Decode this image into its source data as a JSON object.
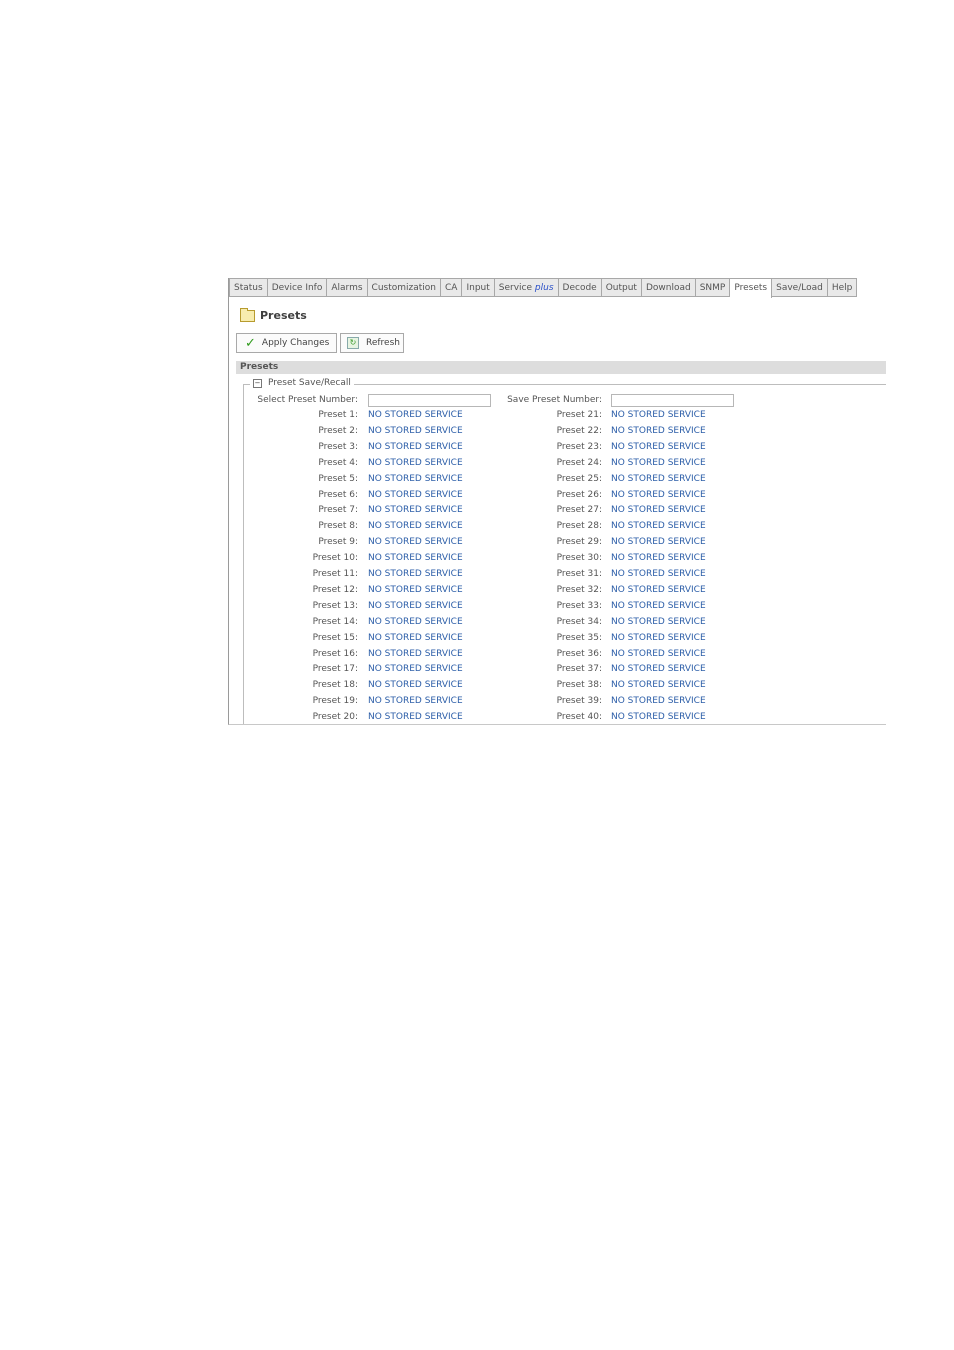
{
  "tabs": [
    {
      "label": "Status",
      "active": false
    },
    {
      "label": "Device Info",
      "active": false
    },
    {
      "label": "Alarms",
      "active": false
    },
    {
      "label": "Customization",
      "active": false
    },
    {
      "label": "CA",
      "active": false
    },
    {
      "label": "Input",
      "active": false
    },
    {
      "label": "Service",
      "suffix": "plus",
      "active": false
    },
    {
      "label": "Decode",
      "active": false
    },
    {
      "label": "Output",
      "active": false
    },
    {
      "label": "Download",
      "active": false
    },
    {
      "label": "SNMP",
      "active": false
    },
    {
      "label": "Presets",
      "active": true
    },
    {
      "label": "Save/Load",
      "active": false
    },
    {
      "label": "Help",
      "active": false
    }
  ],
  "page": {
    "title": "Presets",
    "icon": "folder-icon"
  },
  "toolbar": {
    "apply_label": "Apply Changes",
    "refresh_label": "Refresh"
  },
  "section": {
    "header": "Presets",
    "fieldset_legend": "Preset Save/Recall"
  },
  "form": {
    "select_label": "Select Preset Number:",
    "select_value": "",
    "save_label": "Save Preset Number:",
    "save_value": ""
  },
  "presets_left": [
    {
      "label": "Preset 1:",
      "value": "NO STORED SERVICE"
    },
    {
      "label": "Preset 2:",
      "value": "NO STORED SERVICE"
    },
    {
      "label": "Preset 3:",
      "value": "NO STORED SERVICE"
    },
    {
      "label": "Preset 4:",
      "value": "NO STORED SERVICE"
    },
    {
      "label": "Preset 5:",
      "value": "NO STORED SERVICE"
    },
    {
      "label": "Preset 6:",
      "value": "NO STORED SERVICE"
    },
    {
      "label": "Preset 7:",
      "value": "NO STORED SERVICE"
    },
    {
      "label": "Preset 8:",
      "value": "NO STORED SERVICE"
    },
    {
      "label": "Preset 9:",
      "value": "NO STORED SERVICE"
    },
    {
      "label": "Preset 10:",
      "value": "NO STORED SERVICE"
    },
    {
      "label": "Preset 11:",
      "value": "NO STORED SERVICE"
    },
    {
      "label": "Preset 12:",
      "value": "NO STORED SERVICE"
    },
    {
      "label": "Preset 13:",
      "value": "NO STORED SERVICE"
    },
    {
      "label": "Preset 14:",
      "value": "NO STORED SERVICE"
    },
    {
      "label": "Preset 15:",
      "value": "NO STORED SERVICE"
    },
    {
      "label": "Preset 16:",
      "value": "NO STORED SERVICE"
    },
    {
      "label": "Preset 17:",
      "value": "NO STORED SERVICE"
    },
    {
      "label": "Preset 18:",
      "value": "NO STORED SERVICE"
    },
    {
      "label": "Preset 19:",
      "value": "NO STORED SERVICE"
    },
    {
      "label": "Preset 20:",
      "value": "NO STORED SERVICE"
    }
  ],
  "presets_right": [
    {
      "label": "Preset 21:",
      "value": "NO STORED SERVICE"
    },
    {
      "label": "Preset 22:",
      "value": "NO STORED SERVICE"
    },
    {
      "label": "Preset 23:",
      "value": "NO STORED SERVICE"
    },
    {
      "label": "Preset 24:",
      "value": "NO STORED SERVICE"
    },
    {
      "label": "Preset 25:",
      "value": "NO STORED SERVICE"
    },
    {
      "label": "Preset 26:",
      "value": "NO STORED SERVICE"
    },
    {
      "label": "Preset 27:",
      "value": "NO STORED SERVICE"
    },
    {
      "label": "Preset 28:",
      "value": "NO STORED SERVICE"
    },
    {
      "label": "Preset 29:",
      "value": "NO STORED SERVICE"
    },
    {
      "label": "Preset 30:",
      "value": "NO STORED SERVICE"
    },
    {
      "label": "Preset 31:",
      "value": "NO STORED SERVICE"
    },
    {
      "label": "Preset 32:",
      "value": "NO STORED SERVICE"
    },
    {
      "label": "Preset 33:",
      "value": "NO STORED SERVICE"
    },
    {
      "label": "Preset 34:",
      "value": "NO STORED SERVICE"
    },
    {
      "label": "Preset 35:",
      "value": "NO STORED SERVICE"
    },
    {
      "label": "Preset 36:",
      "value": "NO STORED SERVICE"
    },
    {
      "label": "Preset 37:",
      "value": "NO STORED SERVICE"
    },
    {
      "label": "Preset 38:",
      "value": "NO STORED SERVICE"
    },
    {
      "label": "Preset 39:",
      "value": "NO STORED SERVICE"
    },
    {
      "label": "Preset 40:",
      "value": "NO STORED SERVICE"
    }
  ],
  "colors": {
    "link": "#2c5ea8",
    "plus_accent": "#2b50c8",
    "check": "#2f9b1c"
  }
}
